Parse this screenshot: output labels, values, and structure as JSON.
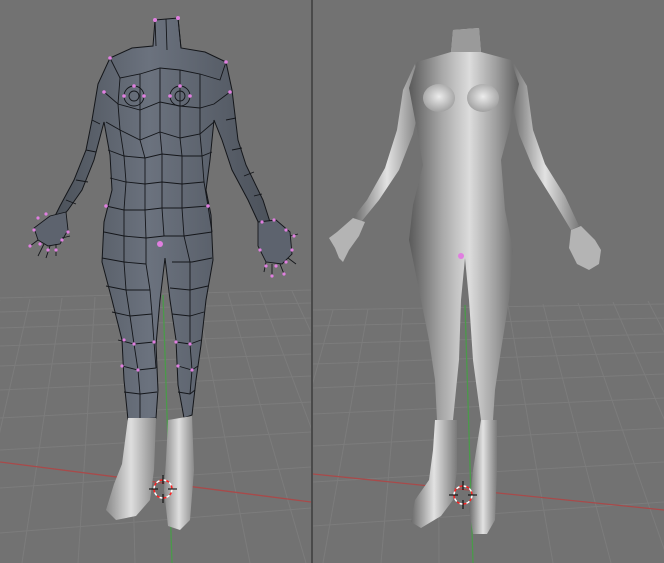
{
  "colors": {
    "viewport_bg": "#727272",
    "grid_line": "#7f7f7f",
    "x_axis": "#a84a4a",
    "y_axis": "#4a9a4a",
    "mesh_fill": "#5d636e",
    "mesh_wire": "#14161a",
    "vertex": "#e07fe0",
    "smooth_mid": "#a0a0a0",
    "smooth_light": "#e4e4e4",
    "smooth_dark": "#4a4a4a",
    "cursor_red": "#ff2020",
    "cursor_white": "#ffffff",
    "boot": "#b8b8b8"
  },
  "viewports": [
    {
      "name": "edit-mode-view",
      "shading": "wireframe-over-solid",
      "object": "female-body-mesh",
      "vertices_selected": true
    },
    {
      "name": "object-mode-view",
      "shading": "smooth",
      "object": "female-body-mesh-subsurf",
      "vertices_selected": false
    }
  ],
  "icons": {
    "cursor": "3d-cursor-icon",
    "origin": "object-origin-icon"
  }
}
